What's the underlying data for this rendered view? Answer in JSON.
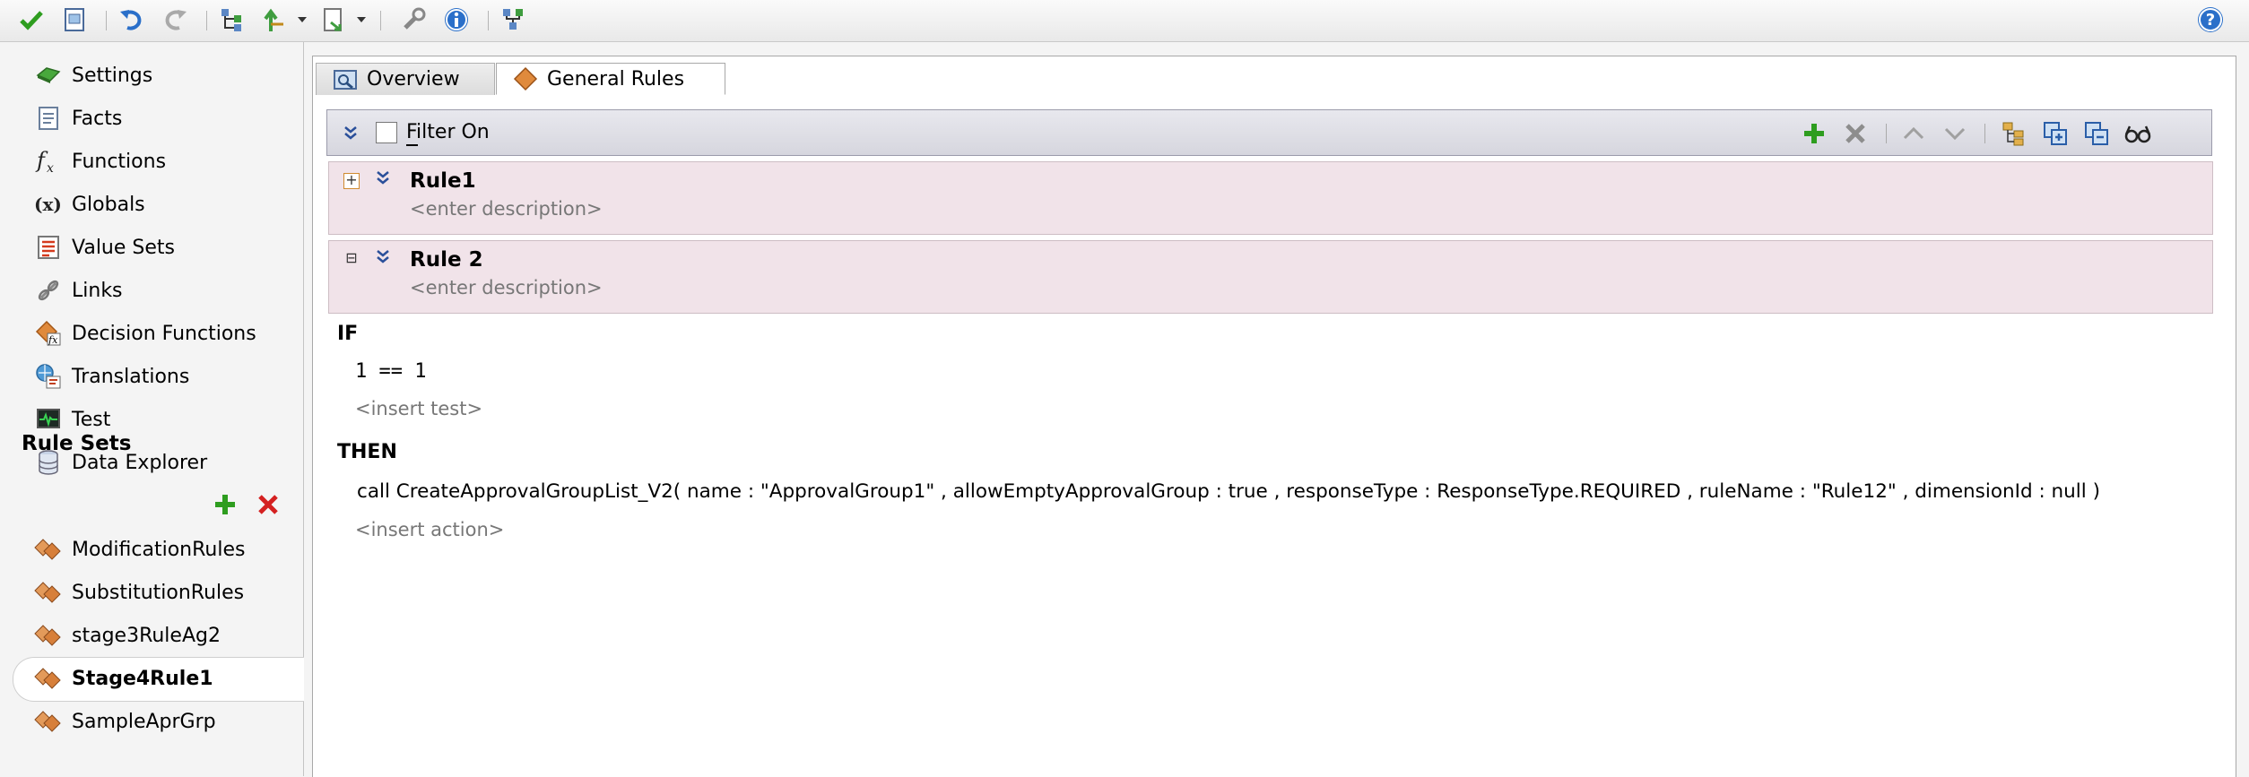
{
  "sidebar": {
    "nav": [
      {
        "label": "Settings",
        "icon": "settings-icon"
      },
      {
        "label": "Facts",
        "icon": "facts-icon"
      },
      {
        "label": "Functions",
        "icon": "functions-icon"
      },
      {
        "label": "Globals",
        "icon": "globals-icon"
      },
      {
        "label": "Value Sets",
        "icon": "value-sets-icon"
      },
      {
        "label": "Links",
        "icon": "links-icon"
      },
      {
        "label": "Decision Functions",
        "icon": "decision-functions-icon"
      },
      {
        "label": "Translations",
        "icon": "translations-icon"
      },
      {
        "label": "Test",
        "icon": "test-icon"
      },
      {
        "label": "Data Explorer",
        "icon": "data-explorer-icon"
      }
    ],
    "rule_sets_heading": "Rule Sets",
    "rule_sets": [
      {
        "label": "ModificationRules"
      },
      {
        "label": "SubstitutionRules"
      },
      {
        "label": "stage3RuleAg2"
      },
      {
        "label": "Stage4Rule1",
        "selected": true
      },
      {
        "label": "SampleAprGrp"
      }
    ]
  },
  "tabs": [
    {
      "label": "Overview",
      "icon": "overview-icon"
    },
    {
      "label": "General Rules",
      "icon": "rule-diamond-icon",
      "active": true
    }
  ],
  "filter": {
    "label": "Filter On",
    "checked": false
  },
  "rules": [
    {
      "name": "Rule1",
      "description": "<enter description>",
      "expanded": false
    },
    {
      "name": "Rule 2",
      "description": "<enter description>",
      "expanded": true
    }
  ],
  "rule_body": {
    "if_label": "IF",
    "test": "1 == 1",
    "insert_test": "<insert test>",
    "then_label": "THEN",
    "action": "call CreateApprovalGroupList_V2( name : \"ApprovalGroup1\" , allowEmptyApprovalGroup : true , responseType : ResponseType.REQUIRED , ruleName : \"Rule12\" , dimensionId : null )",
    "insert_action": "<insert action>"
  },
  "colors": {
    "accent_green": "#2e9d1f",
    "delete_red": "#d42020",
    "rule_bg": "#f1e3e9",
    "help_blue": "#2a6fc9"
  }
}
